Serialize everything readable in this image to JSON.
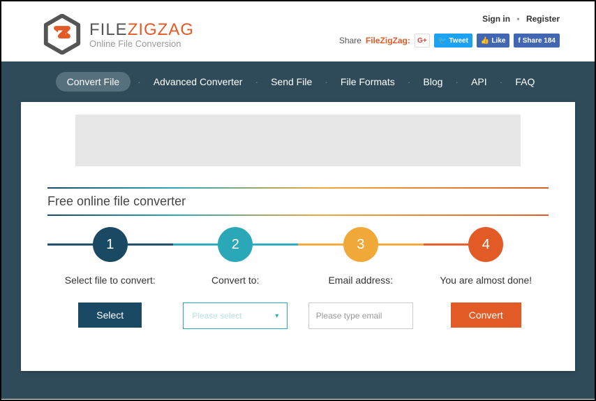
{
  "brand": {
    "pre": "FILE",
    "zig": "ZIGZAG",
    "sub": "Online File Conversion"
  },
  "auth": {
    "signin": "Sign in",
    "register": "Register"
  },
  "share": {
    "label": "Share",
    "brand": "FileZigZag:",
    "gplus": "G+",
    "tweet": "Tweet",
    "like": "Like",
    "share": "Share 184"
  },
  "nav": [
    "Convert File",
    "Advanced Converter",
    "Send File",
    "File Formats",
    "Blog",
    "API",
    "FAQ"
  ],
  "section_title": "Free online file converter",
  "steps": [
    {
      "num": "1",
      "label": "Select file to convert:"
    },
    {
      "num": "2",
      "label": "Convert to:"
    },
    {
      "num": "3",
      "label": "Email address:"
    },
    {
      "num": "4",
      "label": "You are almost done!"
    }
  ],
  "controls": {
    "select_btn": "Select",
    "dropdown_placeholder": "Please select",
    "email_placeholder": "Please type email",
    "convert_btn": "Convert"
  }
}
